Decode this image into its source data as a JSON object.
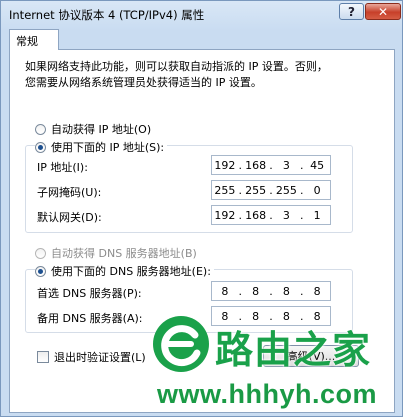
{
  "window": {
    "title": "Internet 协议版本 4 (TCP/IPv4) 属性",
    "help_label": "?",
    "close_label": "✕"
  },
  "tabs": [
    {
      "label": "常规"
    }
  ],
  "description": {
    "line1": "如果网络支持此功能，则可以获取自动指派的 IP 设置。否则，",
    "line2": "您需要从网络系统管理员处获得适当的 IP 设置。"
  },
  "ip_section": {
    "auto_label": "自动获得 IP 地址(O)",
    "manual_label": "使用下面的 IP 地址(S):",
    "selected": "manual",
    "fields": [
      {
        "label": "IP 地址(I):",
        "octets": [
          "192",
          "168",
          "3",
          "45"
        ]
      },
      {
        "label": "子网掩码(U):",
        "octets": [
          "255",
          "255",
          "255",
          "0"
        ]
      },
      {
        "label": "默认网关(D):",
        "octets": [
          "192",
          "168",
          "3",
          "1"
        ]
      }
    ]
  },
  "dns_section": {
    "auto_label": "自动获得 DNS 服务器地址(B)",
    "manual_label": "使用下面的 DNS 服务器地址(E):",
    "selected": "manual",
    "fields": [
      {
        "label": "首选 DNS 服务器(P):",
        "octets": [
          "8",
          "8",
          "8",
          "8"
        ]
      },
      {
        "label": "备用 DNS 服务器(A):",
        "octets": [
          "8",
          "8",
          "8",
          "8"
        ]
      }
    ]
  },
  "validate_label": "退出时验证设置(L)",
  "advanced_label": "高级(V)...",
  "watermark": {
    "brand": "路由之家",
    "url": "www.hhhyh.com",
    "color": "#1aa14a"
  }
}
